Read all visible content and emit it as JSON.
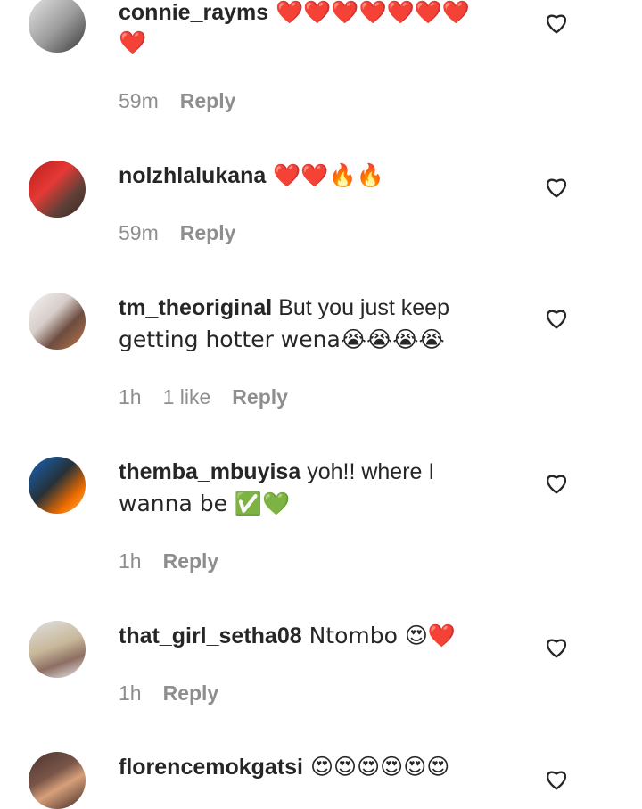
{
  "comments": [
    {
      "username": "connie_rayms",
      "text_line1": " ❤️❤️❤️❤️❤️❤️❤️",
      "text_line2": "❤️",
      "time": "59m",
      "likes": "",
      "reply": "Reply"
    },
    {
      "username": "nolzhlalukana",
      "text_line1": " ❤️❤️🔥🔥",
      "text_line2": "",
      "time": "59m",
      "likes": "",
      "reply": "Reply"
    },
    {
      "username": "tm_theoriginal",
      "text_line1": " But you just keep",
      "text_line2": "getting hotter wena😭😭😭😭",
      "time": "1h",
      "likes": "1 like",
      "reply": "Reply"
    },
    {
      "username": "themba_mbuyisa",
      "text_line1": " yoh!! where I",
      "text_line2": "wanna be ✅💚",
      "time": "1h",
      "likes": "",
      "reply": "Reply"
    },
    {
      "username": "that_girl_setha08",
      "text_line1": " Ntombo 😍❤️",
      "text_line2": "",
      "time": "1h",
      "likes": "",
      "reply": "Reply"
    },
    {
      "username": "florencemokgatsi",
      "text_line1": " 😍😍😍😍😍😍",
      "text_line2": "",
      "time": "",
      "likes": "",
      "reply": ""
    }
  ],
  "icons": {
    "like": "heart-outline-icon"
  },
  "colors": {
    "text": "#262626",
    "secondary": "#8e8e8e",
    "background": "#ffffff"
  }
}
